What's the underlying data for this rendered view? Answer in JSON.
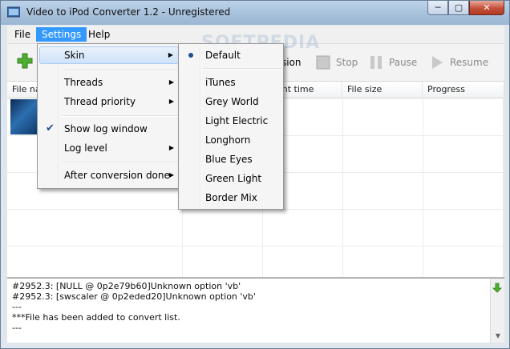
{
  "window": {
    "title": "Video to iPod Converter 1.2 - Unregistered"
  },
  "menubar": {
    "file": "File",
    "settings": "Settings",
    "help": "Help"
  },
  "toolbar": {
    "conversion_fragment": "sion",
    "stop": "Stop",
    "pause": "Pause",
    "resume": "Resume"
  },
  "table": {
    "columns": [
      "File na",
      "ent time",
      "File size",
      "Progress"
    ]
  },
  "settings_menu": {
    "items": [
      {
        "label": "Skin"
      },
      {
        "label": "Threads"
      },
      {
        "label": "Thread priority"
      },
      {
        "label": "Show log window"
      },
      {
        "label": "Log level"
      },
      {
        "label": "After conversion done"
      }
    ]
  },
  "skin_menu": {
    "items": [
      "Default",
      "iTunes",
      "Grey World",
      "Light Electric",
      "Longhorn",
      "Blue Eyes",
      "Green Light",
      "Border Mix"
    ]
  },
  "log": {
    "lines": [
      "#2952.3: [NULL @ 0p2e79b60]Unknown option 'vb'",
      "#2952.3: [swscaler @ 0p2eded20]Unknown option 'vb'",
      "---",
      "***File has been added to convert list.",
      "---"
    ]
  },
  "watermark": "SOFTPEDIA",
  "colors": {
    "menu_highlight": "#3399ff",
    "add_green": "#4caf30"
  }
}
